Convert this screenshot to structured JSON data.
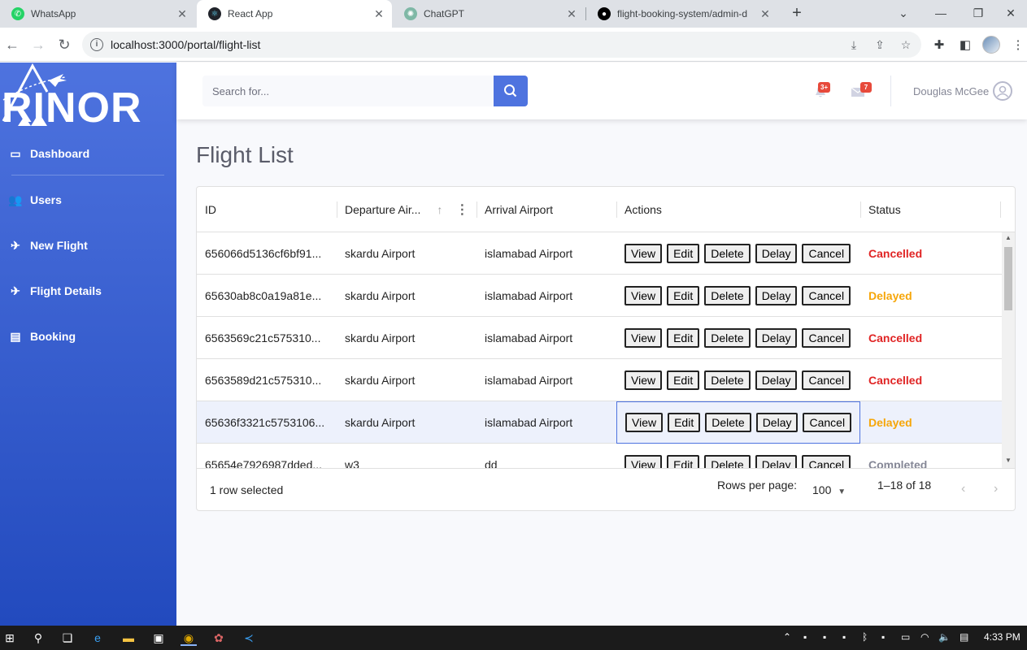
{
  "browser": {
    "tabs": [
      {
        "title": "WhatsApp",
        "icon": "whatsapp-icon",
        "color": "#25d366",
        "active": false
      },
      {
        "title": "React App",
        "icon": "react-icon",
        "color": "#61dafb",
        "active": true
      },
      {
        "title": "ChatGPT",
        "icon": "chatgpt-icon",
        "color": "#10a37f",
        "active": false
      },
      {
        "title": "flight-booking-system/admin-d",
        "icon": "github-icon",
        "color": "#000000",
        "active": false
      }
    ],
    "url": "localhost:3000/portal/flight-list"
  },
  "sidebar": {
    "brand": "RINOR",
    "items": [
      {
        "label": "Dashboard",
        "icon": "dashboard-icon"
      },
      {
        "label": "Users",
        "icon": "users-icon"
      },
      {
        "label": "New Flight",
        "icon": "plane-icon"
      },
      {
        "label": "Flight Details",
        "icon": "plane-icon"
      },
      {
        "label": "Booking",
        "icon": "book-icon"
      }
    ]
  },
  "topbar": {
    "search_placeholder": "Search for...",
    "alerts_badge": "3+",
    "messages_badge": "7",
    "user_name": "Douglas McGee"
  },
  "page": {
    "title": "Flight List"
  },
  "grid": {
    "columns": [
      "ID",
      "Departure Air...",
      "Arrival Airport",
      "Actions",
      "Status"
    ],
    "action_labels": [
      "View",
      "Edit",
      "Delete",
      "Delay",
      "Cancel"
    ],
    "rows": [
      {
        "id": "656066d5136cf6bf91...",
        "departure": "skardu Airport",
        "arrival": "islamabad Airport",
        "status": "Cancelled",
        "status_color": "#e02424"
      },
      {
        "id": "65630ab8c0a19a81e...",
        "departure": "skardu Airport",
        "arrival": "islamabad Airport",
        "status": "Delayed",
        "status_color": "#f6a609"
      },
      {
        "id": "6563569c21c575310...",
        "departure": "skardu Airport",
        "arrival": "islamabad Airport",
        "status": "Cancelled",
        "status_color": "#e02424"
      },
      {
        "id": "6563589d21c575310...",
        "departure": "skardu Airport",
        "arrival": "islamabad Airport",
        "status": "Cancelled",
        "status_color": "#e02424"
      },
      {
        "id": "65636f3321c5753106...",
        "departure": "skardu Airport",
        "arrival": "islamabad Airport",
        "status": "Delayed",
        "status_color": "#f6a609",
        "selected": true
      },
      {
        "id": "65654e7926987dded...",
        "departure": "w3",
        "arrival": "dd",
        "status": "Completed",
        "status_color": "#858796"
      }
    ],
    "footer": {
      "selected_text": "1 row selected",
      "rows_per_page_label": "Rows per page:",
      "rows_per_page_value": "100",
      "range": "1–18 of 18"
    }
  },
  "taskbar": {
    "time": "4:33 PM"
  }
}
